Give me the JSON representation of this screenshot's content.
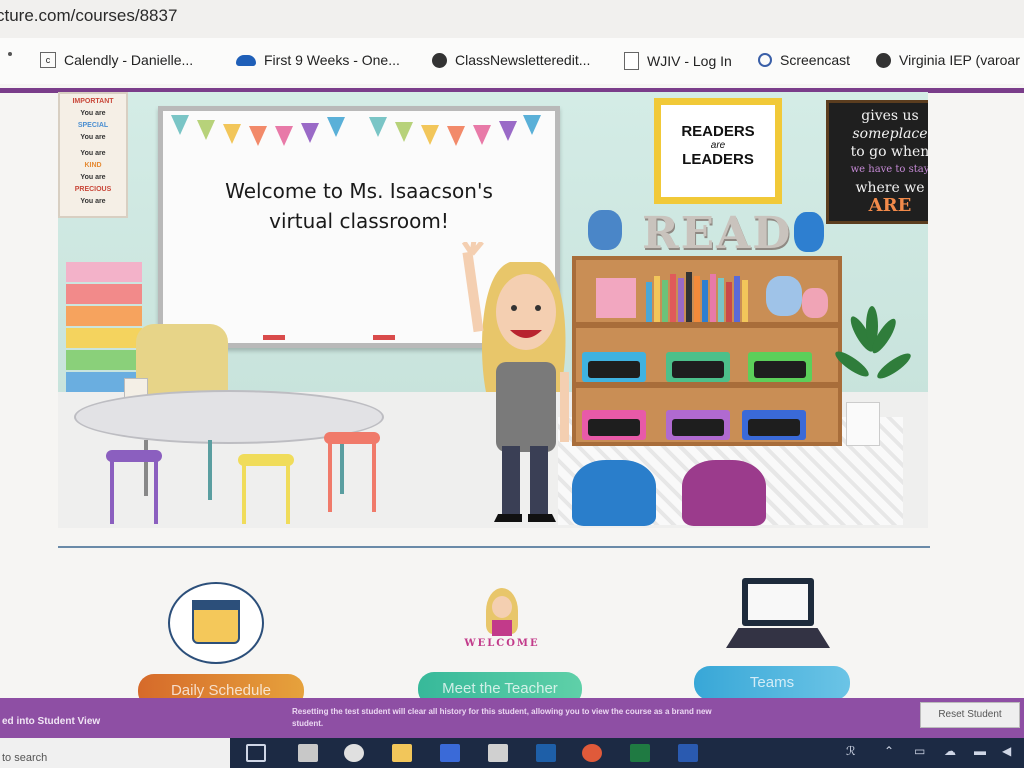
{
  "browser": {
    "url": "cture.com/courses/8837",
    "bookmarks": [
      {
        "label": "Calendly - Danielle...",
        "icon": "calendly-icon"
      },
      {
        "label": "First 9 Weeks - One...",
        "icon": "onedrive-cloud-icon"
      },
      {
        "label": "ClassNewsletteredit...",
        "icon": "globe-icon"
      },
      {
        "label": "WJIV - Log In",
        "icon": "document-icon"
      },
      {
        "label": "Screencast",
        "icon": "screencast-icon"
      },
      {
        "label": "Virginia IEP (varoar",
        "icon": "globe-icon"
      }
    ]
  },
  "classroom": {
    "welcome_line1": "Welcome to Ms. Isaacson's",
    "welcome_line2": "virtual classroom!",
    "readers_line1": "READERS",
    "readers_line2": "are",
    "readers_line3": "LEADERS",
    "read_letters": "READ",
    "chalk_line1": "gives us",
    "chalk_line2": "someplace",
    "chalk_line3": "to go when",
    "chalk_line4": "we have to stay",
    "chalk_line5": "where we",
    "chalk_line6": "ARE",
    "poster_lines": [
      "IMPORTANT",
      "You are",
      "SPECIAL",
      "You are",
      "You are",
      "KIND",
      "You are",
      "PRECIOUS",
      "You are"
    ]
  },
  "nav": {
    "schedule_label": "Daily Schedule",
    "meet_label": "Meet the Teacher",
    "teams_label": "Teams",
    "welcome_caption": "WELCOME"
  },
  "student_view": {
    "label": "ed into Student View",
    "note": "Resetting the test student will clear all history for this student, allowing you to view the course as a brand new student.",
    "reset_label": "Reset Student"
  },
  "taskbar": {
    "search_placeholder": "to search"
  },
  "colors": {
    "accent_purple": "#8e4fa4",
    "schedule_orange": "#d66a2a",
    "meet_green": "#37b99a",
    "teams_blue": "#38a7d7"
  }
}
